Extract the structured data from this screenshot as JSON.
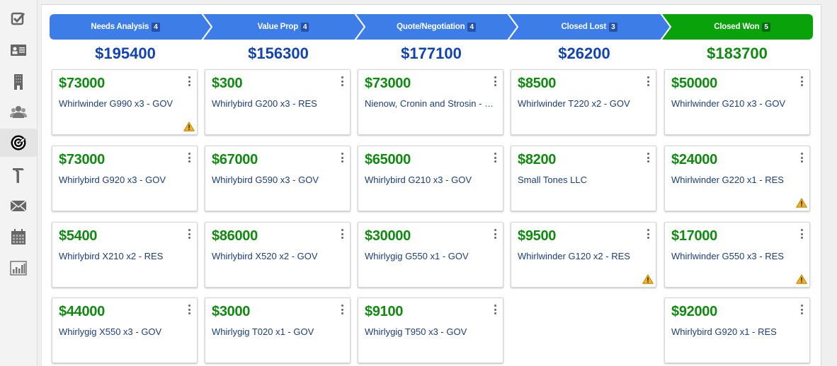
{
  "sidebar": {
    "items": [
      {
        "name": "tasks",
        "icon": "checkbox-icon",
        "active": false
      },
      {
        "name": "contacts",
        "icon": "contact-card-icon",
        "active": false
      },
      {
        "name": "companies",
        "icon": "building-icon",
        "active": false
      },
      {
        "name": "users",
        "icon": "users-icon",
        "active": false
      },
      {
        "name": "opportunities",
        "icon": "target-icon",
        "active": true
      },
      {
        "name": "tools",
        "icon": "hammer-icon",
        "active": false
      },
      {
        "name": "mail",
        "icon": "envelope-icon",
        "active": false
      },
      {
        "name": "calendar",
        "icon": "calendar-icon",
        "active": false
      },
      {
        "name": "reports",
        "icon": "bar-chart-icon",
        "active": false
      }
    ]
  },
  "colors": {
    "stage_blue": "#3d7de8",
    "stage_green": "#0aa20a",
    "total_blue": "#1144b0",
    "total_green": "#118a11",
    "amount_green": "#118a11",
    "name_blue": "#1c3f7a",
    "warning": "#f0b020"
  },
  "stages": [
    {
      "label": "Needs Analysis",
      "count": "4",
      "total": "$195400",
      "color": "blue",
      "cards": [
        {
          "amount": "$73000",
          "name": "Whirlwinder G990 x3 - GOV",
          "warning": true
        },
        {
          "amount": "$73000",
          "name": "Whirlybird G920 x3 - GOV",
          "warning": false
        },
        {
          "amount": "$5400",
          "name": "Whirlybird X210 x2 - RES",
          "warning": false
        },
        {
          "amount": "$44000",
          "name": "Whirlygig X550 x3 - GOV",
          "warning": false
        }
      ]
    },
    {
      "label": "Value Prop",
      "count": "4",
      "total": "$156300",
      "color": "blue",
      "cards": [
        {
          "amount": "$300",
          "name": "Whirlybird G200 x3 - RES",
          "warning": false
        },
        {
          "amount": "$67000",
          "name": "Whirlybird G590 x3 - GOV",
          "warning": false
        },
        {
          "amount": "$86000",
          "name": "Whirlybird X520 x2 - GOV",
          "warning": false
        },
        {
          "amount": "$3000",
          "name": "Whirlygig T020 x1 - GOV",
          "warning": false
        }
      ]
    },
    {
      "label": "Quote/Negotiation",
      "count": "4",
      "total": "$177100",
      "color": "blue",
      "cards": [
        {
          "amount": "$73000",
          "name": "Nienow, Cronin and Strosin - …",
          "warning": false
        },
        {
          "amount": "$65000",
          "name": "Whirlybird G210 x3 - GOV",
          "warning": false
        },
        {
          "amount": "$30000",
          "name": "Whirlygig G550 x1 - GOV",
          "warning": false
        },
        {
          "amount": "$9100",
          "name": "Whirlygig T950 x3 - GOV",
          "warning": false
        }
      ]
    },
    {
      "label": "Closed Lost",
      "count": "3",
      "total": "$26200",
      "color": "blue",
      "cards": [
        {
          "amount": "$8500",
          "name": "Whirlwinder T220 x2 - GOV",
          "warning": false
        },
        {
          "amount": "$8200",
          "name": "Small Tones LLC",
          "warning": false
        },
        {
          "amount": "$9500",
          "name": "Whirlwinder G120 x2 - RES",
          "warning": true
        }
      ]
    },
    {
      "label": "Closed Won",
      "count": "5",
      "total": "$183700",
      "color": "green",
      "cards": [
        {
          "amount": "$50000",
          "name": "Whirlwinder G210 x3 - GOV",
          "warning": false
        },
        {
          "amount": "$24000",
          "name": "Whirlwinder G220 x1 - RES",
          "warning": true
        },
        {
          "amount": "$17000",
          "name": "Whirlwinder G550 x3 - RES",
          "warning": true
        },
        {
          "amount": "$92000",
          "name": "Whirlybird G920 x1 - RES",
          "warning": false
        }
      ]
    }
  ]
}
